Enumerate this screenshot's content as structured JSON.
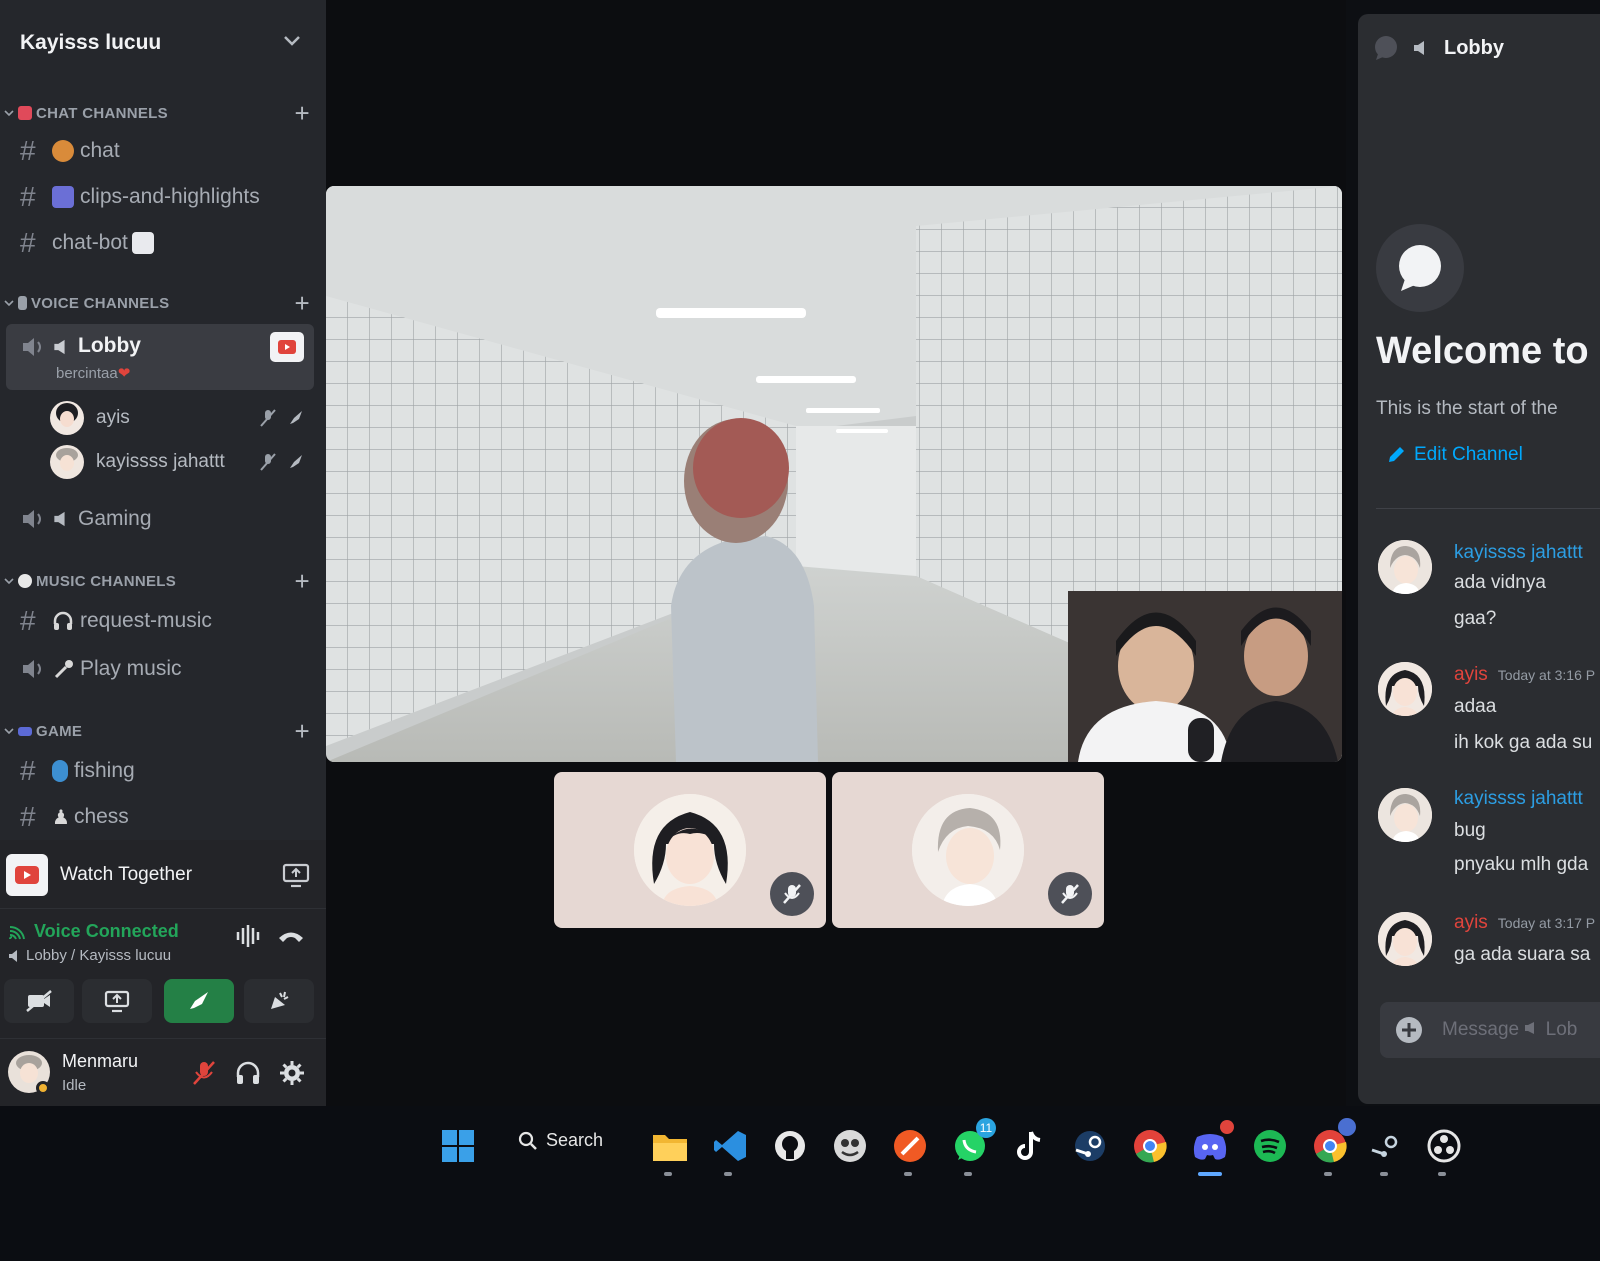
{
  "server": {
    "name": "Kayisss lucuu"
  },
  "categories": {
    "chat": "CHAT CHANNELS",
    "voice": "VOICE CHANNELS",
    "music": "MUSIC CHANNELS",
    "game": "GAME"
  },
  "text_channels": {
    "chat": "chat",
    "clips": "clips-and-highlights",
    "chatbot": "chat-bot",
    "request_music": "request-music",
    "fishing": "fishing",
    "chess": "chess"
  },
  "voice_channels": {
    "lobby": {
      "name": "Lobby",
      "status": "bercintaa"
    },
    "gaming": "Gaming",
    "play_music": "Play music"
  },
  "voice_users": [
    {
      "name": "ayis"
    },
    {
      "name": "kayissss jahattt"
    }
  ],
  "activity": {
    "label": "Watch Together"
  },
  "voice_connection": {
    "status": "Voice Connected",
    "location": "Lobby / Kayisss lucuu"
  },
  "user": {
    "name": "Menmaru",
    "status": "Idle"
  },
  "chat_panel": {
    "channel": "Lobby",
    "welcome_title": "Welcome to",
    "welcome_sub": "This is the start of the",
    "edit_channel": "Edit Channel",
    "messages": [
      {
        "author": "kayissss jahattt",
        "time": "",
        "lines": [
          "ada vidnya",
          "gaa?"
        ]
      },
      {
        "author": "ayis",
        "time": "Today at 3:16 P",
        "lines": [
          "adaa",
          "ih kok ga ada su"
        ]
      },
      {
        "author": "kayissss jahattt",
        "time": "",
        "lines": [
          "bug",
          "pnyaku mlh gda"
        ]
      },
      {
        "author": "ayis",
        "time": "Today at 3:17 P",
        "lines": [
          "ga ada suara sa"
        ]
      }
    ],
    "composer_placeholder": "Message",
    "composer_channel": "Lob"
  },
  "taskbar": {
    "search_label": "Search",
    "whatsapp_badge": "11"
  },
  "colors": {
    "sidebar_bg": "#25272c",
    "chat_bg": "#2b2d31",
    "accent_green": "#23a55a",
    "link_blue": "#00a8fc",
    "author_blue": "#2c9ee3",
    "author_red": "#e0443c"
  }
}
